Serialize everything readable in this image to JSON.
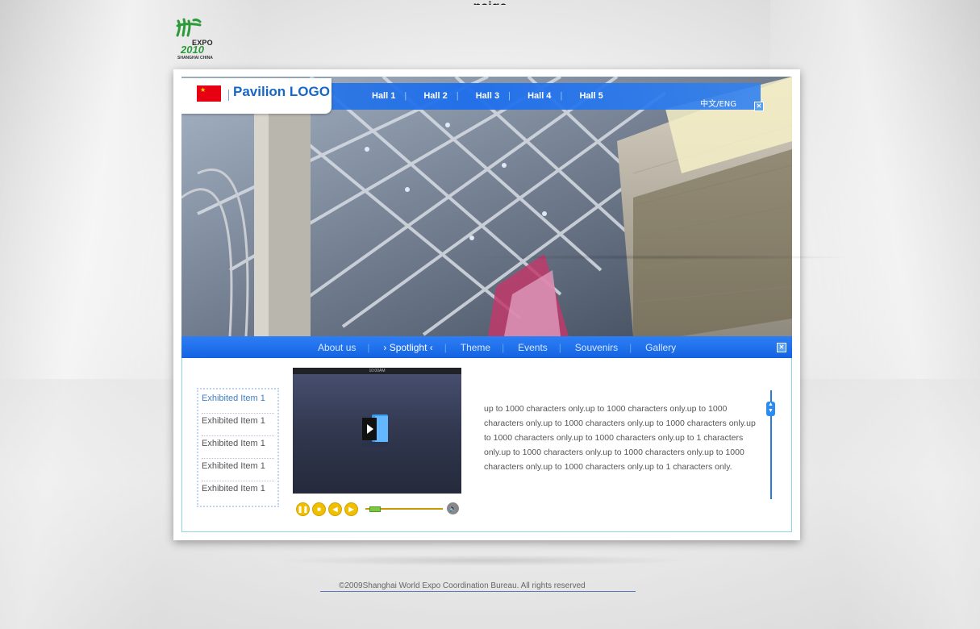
{
  "page": {
    "title": "paige"
  },
  "expo_logo": {
    "expo": "EXPO",
    "year": "2010",
    "city": "SHANGHAI CHINA"
  },
  "header": {
    "logo_text": "Pavilion LOGO",
    "halls": [
      "Hall 1",
      "Hall 2",
      "Hall 3",
      "Hall 4",
      "Hall 5"
    ],
    "language": "中文/ENG"
  },
  "nav": {
    "items": [
      "About us",
      "› Spotlight ‹",
      "Theme",
      "Events",
      "Souvenirs",
      "Gallery"
    ],
    "active_index": 1
  },
  "sidebar": {
    "items": [
      "Exhibited Item 1",
      "Exhibited Item 1",
      "Exhibited Item 1",
      "Exhibited Item 1",
      "Exhibited Item 1"
    ]
  },
  "video": {
    "status_time": "10:00AM",
    "progress": 0.05
  },
  "description": "up to 1000 characters only.up to 1000 characters only.up to 1000 characters only.up to 1000 characters only.up to 1000 characters only.up to 1000 characters only.up to 1000 characters only.up to 1 characters only.up to 1000 characters only.up to 1000 characters only.up to 1000 characters only.up to 1000 characters only.up to 1 characters only.",
  "footer": {
    "copyright": "©2009Shanghai World Expo Coordination Bureau. All rights reserved"
  },
  "colors": {
    "accent": "#1f6fe8",
    "logo_green": "#2d9a3a",
    "control_yellow": "#f0c000"
  }
}
